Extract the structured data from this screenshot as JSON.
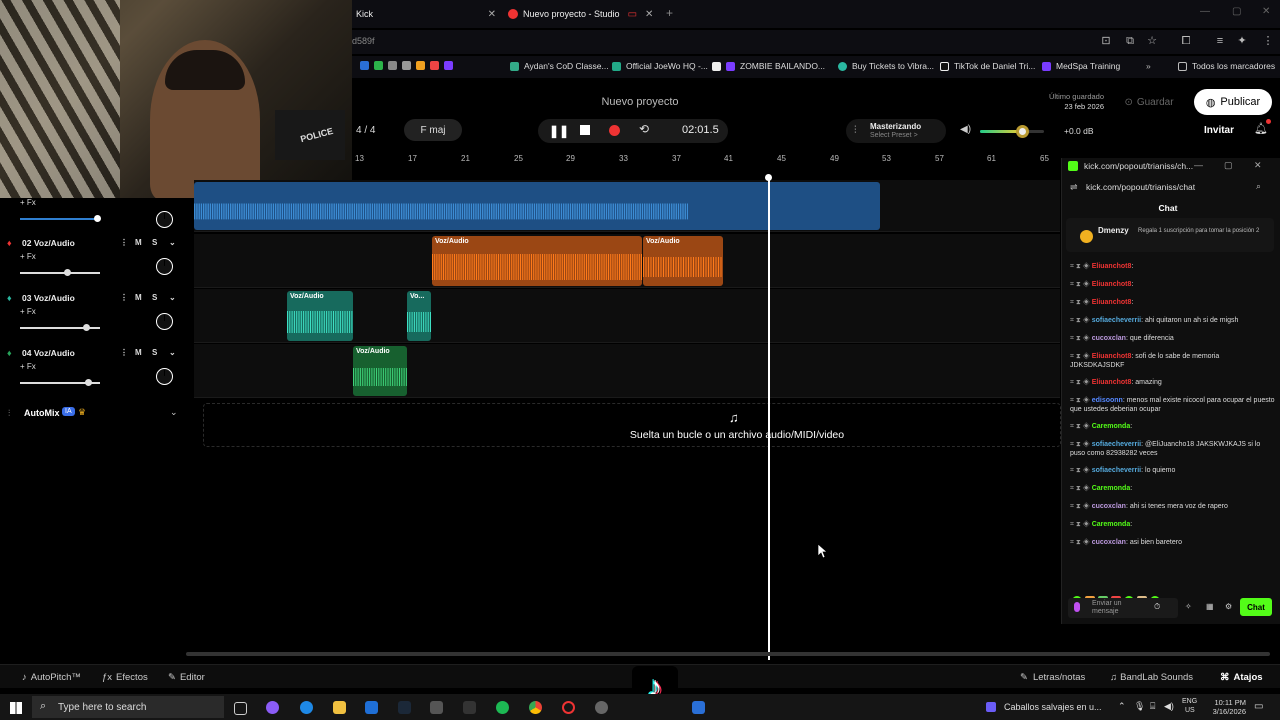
{
  "browser": {
    "tabs": [
      {
        "title": "Kick"
      },
      {
        "title": "Nuevo proyecto - Studio"
      }
    ],
    "url_fragment": "d589f",
    "bookmarks": [
      {
        "label": "Aydan's CoD Classe..."
      },
      {
        "label": "Official JoeWo HQ -..."
      },
      {
        "label": "ZOMBIE BAILANDO..."
      },
      {
        "label": "Buy Tickets to Vibra..."
      },
      {
        "label": "TikTok de Daniel Tri..."
      },
      {
        "label": "MedSpa Training"
      },
      {
        "label": "Todos los marcadores"
      }
    ]
  },
  "studio": {
    "project_title": "Nuevo proyecto",
    "save_status": "Último guardado",
    "save_date": "23 feb 2026",
    "save_button": "Guardar",
    "publish_button": "Publicar",
    "invite_button": "Invitar",
    "time_signature": "4 / 4",
    "key": "F maj",
    "time_display": "02:01.5",
    "mastering_label": "Masterizando",
    "preset_label": "Select Preset >",
    "volume_db": "+0.0 dB",
    "ruler_ticks": [
      "13",
      "17",
      "21",
      "25",
      "29",
      "33",
      "37",
      "41",
      "45",
      "49",
      "53",
      "57",
      "61",
      "65"
    ],
    "tracks": [
      {
        "number": "02",
        "name": "Voz/Audio",
        "fx": "+ Fx",
        "m": "M",
        "s": "S"
      },
      {
        "number": "03",
        "name": "Voz/Audio",
        "fx": "+ Fx",
        "m": "M",
        "s": "S"
      },
      {
        "number": "04",
        "name": "Voz/Audio",
        "fx": "+ Fx",
        "m": "M",
        "s": "S"
      }
    ],
    "first_track_fx": "+ Fx",
    "clip_label": "Voz/Audio",
    "clip_label_short": "Vo...",
    "automix_label": "AutoMix",
    "automix_badge": "IA",
    "drop_hint": "Suelta un bucle o un archivo audio/MIDI/video",
    "bottom": {
      "autopitch": "AutoPitch™",
      "effects": "Efectos",
      "editor": "Editor",
      "lyrics": "Letras/notas",
      "sounds": "BandLab Sounds",
      "shortcuts": "Atajos"
    }
  },
  "chat": {
    "url": "kick.com/popout/trianiss/chat",
    "window_url": "kick.com/popout/trianiss/ch...",
    "header": "Chat",
    "gift_user": "Dmenzy",
    "gift_text": "Regala 1 suscripción para tomar la posición 2",
    "messages": [
      {
        "user": "Eliuanchot8",
        "text": ""
      },
      {
        "user": "Eliuanchot8",
        "text": ""
      },
      {
        "user": "Eliuanchot8",
        "text": ""
      },
      {
        "user": "sofiaecheverrii",
        "text": "ahi quitaron un ah si de migsh"
      },
      {
        "user": "cucoxclan",
        "text": "que diferencia"
      },
      {
        "user": "Eliuanchot8",
        "text": "sofi de lo sabe de memoria JDKSDKAJSDKF"
      },
      {
        "user": "Eliuanchot8",
        "text": "amazing"
      },
      {
        "user": "edisoonn",
        "text": "menos mal existe nicocol para ocupar el puesto que ustedes deberian ocupar"
      },
      {
        "user": "Caremonda",
        "text": ""
      },
      {
        "user": "sofiaecheverrii",
        "text": "@EliJuancho18 JAKSKWJKAJS si lo puso como 82938282 veces"
      },
      {
        "user": "sofiaecheverrii",
        "text": "lo quiemo"
      },
      {
        "user": "Caremonda",
        "text": ""
      },
      {
        "user": "cucoxclan",
        "text": "ahi si tenes mera voz de rapero"
      },
      {
        "user": "Caremonda",
        "text": ""
      },
      {
        "user": "cucoxclan",
        "text": "asi bien baretero"
      }
    ],
    "input_placeholder": "Enviar un mensaje",
    "send_button": "Chat"
  },
  "taskbar": {
    "search_placeholder": "Type here to search",
    "now_playing": "Caballos salvajes en u...",
    "lang": "ENG",
    "region": "US",
    "time": "10:11 PM",
    "date": "3/16/2026"
  },
  "colors": {
    "track1": "#2f7fd0",
    "track2": "#f07020",
    "track3": "#2ab7a0",
    "track4": "#27a35a",
    "record": "#e33",
    "chat_green": "#53fc18"
  }
}
